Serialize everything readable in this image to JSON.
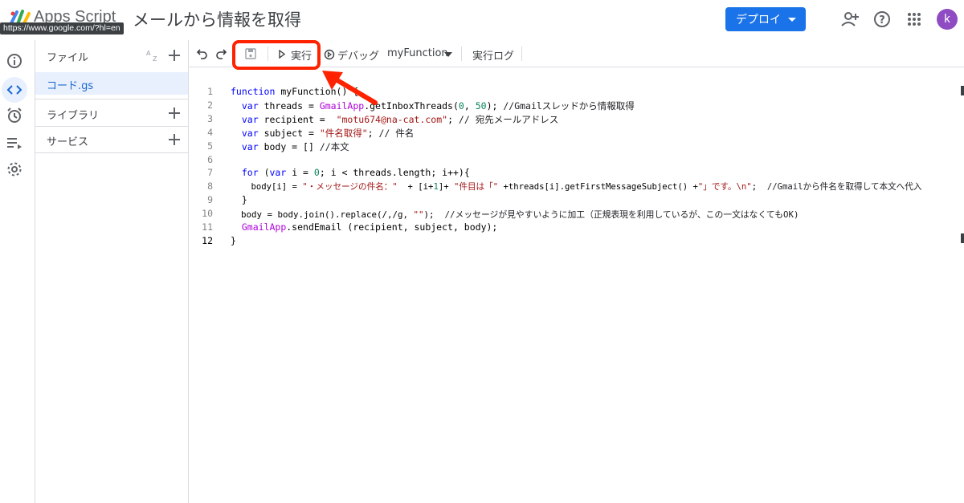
{
  "header": {
    "app_name": "Apps Script",
    "url_tooltip": "https://www.google.com/?hl=en",
    "project_title": "メールから情報を取得",
    "deploy_label": "デプロイ",
    "avatar_letter": "k",
    "icons": [
      "add-person-icon",
      "help-icon",
      "apps-grid-icon"
    ]
  },
  "rail": {
    "items": [
      "info-icon",
      "code-icon",
      "alarm-icon",
      "executions-icon",
      "settings-icon"
    ],
    "active": "code-icon"
  },
  "files_panel": {
    "title": "ファイル",
    "files": [
      {
        "name": "コード.gs",
        "active": true
      }
    ],
    "libraries_label": "ライブラリ",
    "services_label": "サービス"
  },
  "toolbar": {
    "run_label": "実行",
    "debug_label": "デバッグ",
    "function_select": "myFunction",
    "log_label": "実行ログ"
  },
  "code": {
    "line_numbers": [
      "1",
      "2",
      "3",
      "4",
      "5",
      "6",
      "7",
      "8",
      "9",
      "10",
      "11",
      "12"
    ],
    "lines": [
      "function myFunction() {",
      "  var threads = GmailApp.getInboxThreads(0, 50); //Gmailスレッドから情報取得",
      "  var recipient =  \"motu674@na-cat.com\"; // 宛先メールアドレス",
      "  var subject = \"件名取得\"; // 件名",
      "  var body = [] //本文",
      "",
      "  for (var i = 0; i < threads.length; i++){",
      "    body[i] = \"・メッセージの件名：\"  + [i+1]+ \"件目は「\" +threads[i].getFirstMessageSubject() +\"」です。\\n\";  //Gmailから件名を取得して本文へ代入",
      "  }",
      "  body = body.join().replace(/,/g, \"\");  //メッセージが見やすいように加工（正規表現を利用しているが、この一文はなくてもOK)",
      "  GmailApp.sendEmail (recipient, subject, body);",
      "}"
    ]
  },
  "colors": {
    "accent": "#1a73e8",
    "highlight": "#ff2200",
    "keyword": "#0000ff",
    "string": "#a31515"
  }
}
